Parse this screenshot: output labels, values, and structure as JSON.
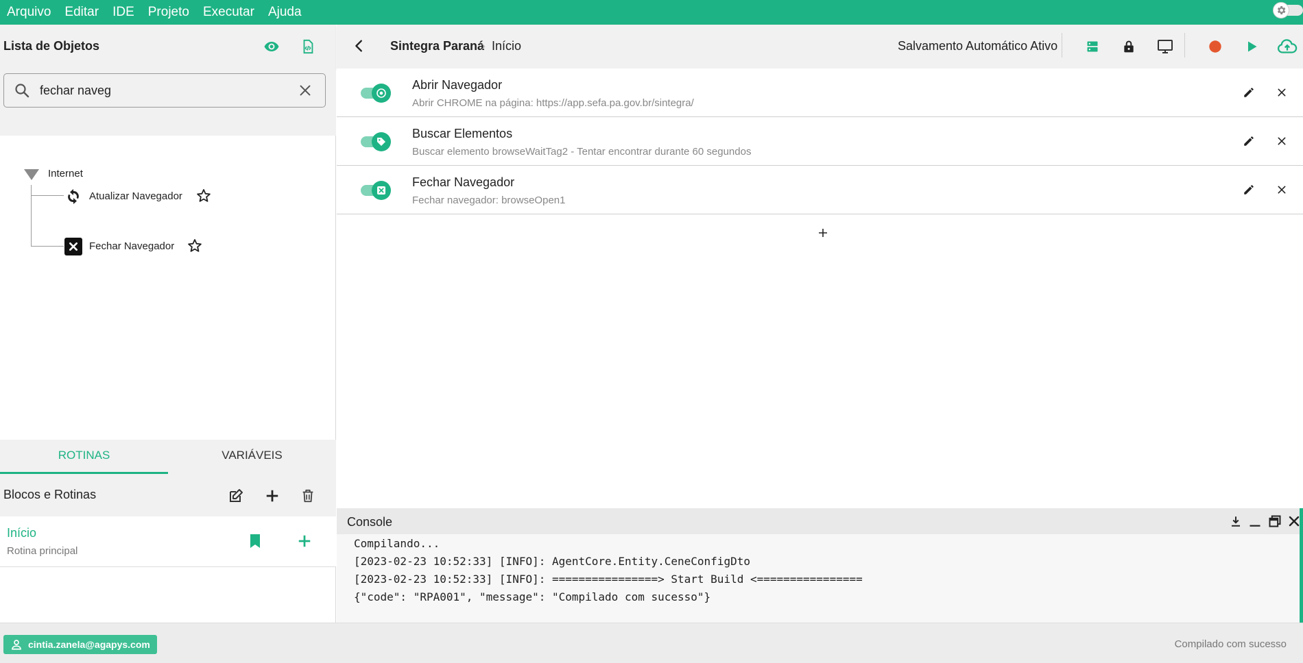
{
  "menu": [
    "Arquivo",
    "Editar",
    "IDE",
    "Projeto",
    "Executar",
    "Ajuda"
  ],
  "objects": {
    "title": "Lista de Objetos",
    "search_value": "fechar naveg"
  },
  "tree": {
    "category": "Internet",
    "items": [
      "Atualizar Navegador",
      "Fechar Navegador"
    ]
  },
  "tabs": [
    "ROTINAS",
    "VARIÁVEIS"
  ],
  "blocks": {
    "title": "Blocos e Rotinas",
    "routine_name": "Início",
    "routine_sub": "Rotina principal"
  },
  "topbar": {
    "project": "Sintegra Paraná",
    "separator": "›",
    "routine": "Início",
    "autosave": "Salvamento Automático Ativo"
  },
  "steps": [
    {
      "name": "Abrir Navegador",
      "desc": "Abrir CHROME na página: https://app.sefa.pa.gov.br/sintegra/"
    },
    {
      "name": "Buscar Elementos",
      "desc": "Buscar elemento browseWaitTag2 - Tentar encontrar durante 60 segundos"
    },
    {
      "name": "Fechar Navegador",
      "desc": "Fechar navegador: browseOpen1"
    }
  ],
  "console": {
    "title": "Console",
    "lines": [
      "Compilando...",
      "[2023-02-23 10:52:33] [INFO]: AgentCore.Entity.CeneConfigDto",
      "[2023-02-23 10:52:33] [INFO]: ================> Start Build <================",
      "{\"code\": \"RPA001\", \"message\": \"Compilado com sucesso\"}"
    ]
  },
  "status": {
    "user": "cintia.zanela@agapys.com",
    "message": "Compilado com sucesso"
  },
  "colors": {
    "accent": "#1eb384",
    "record": "#e4572e"
  }
}
